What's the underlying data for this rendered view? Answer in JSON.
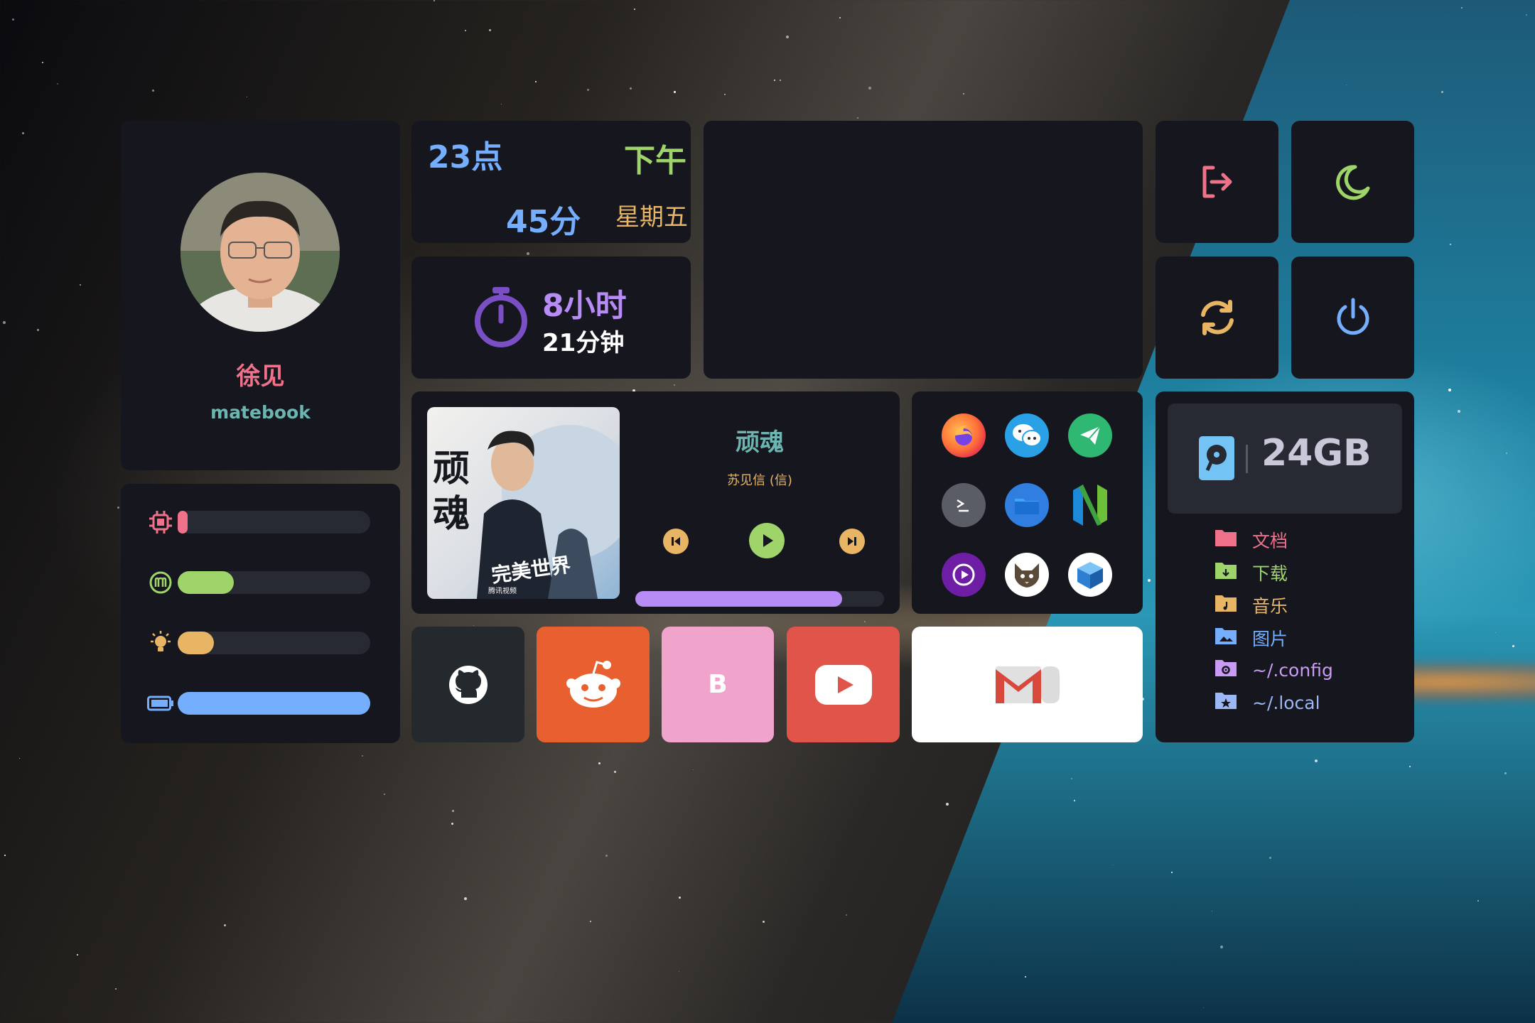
{
  "profile": {
    "name": "徐见",
    "host": "matebook"
  },
  "clock": {
    "hour": "23点",
    "minute": "45分",
    "period": "下午",
    "weekday": "星期五"
  },
  "uptime": {
    "hours": "8小时",
    "minutes": "21分钟"
  },
  "music": {
    "title": "顽魂",
    "artist": "苏见信 (信)",
    "progress": 0.83,
    "cover_text": "顽魂",
    "cover_subtitle": "完美世界",
    "cover_tag": "腾讯视频"
  },
  "system": {
    "cpu": 0.05,
    "ram": 0.29,
    "brightness": 0.19,
    "battery": 1.0
  },
  "disk": {
    "size": "24GB"
  },
  "folders": [
    {
      "label": "文档",
      "color": "#f0718a",
      "icon": "folder-icon"
    },
    {
      "label": "下载",
      "color": "#9ed46a",
      "icon": "folder-download-icon"
    },
    {
      "label": "音乐",
      "color": "#e8b565",
      "icon": "folder-music-icon"
    },
    {
      "label": "图片",
      "color": "#74aefc",
      "icon": "folder-image-icon"
    },
    {
      "label": "~/.config",
      "color": "#c99bf5",
      "icon": "folder-gear-icon"
    },
    {
      "label": "~/.local",
      "color": "#9bb7f5",
      "icon": "folder-star-icon"
    }
  ],
  "bookmarks": {
    "bilibili_letter": "B"
  },
  "colors": {
    "pink": "#f0718a",
    "green": "#9ed46a",
    "orange": "#e8b565",
    "blue": "#74aefc",
    "purple": "#b88cf5",
    "teal": "#6cb5b0",
    "card": "#16161e",
    "track": "#272a33"
  }
}
